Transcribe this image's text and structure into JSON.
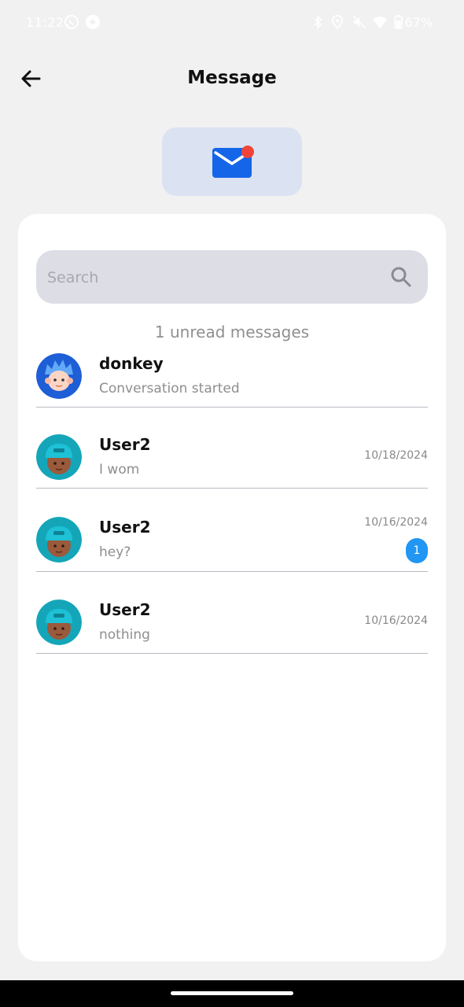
{
  "status_bar": {
    "time": "11:22",
    "battery_percent": "67%",
    "left_icons": [
      "whatsapp-icon",
      "browser-icon"
    ],
    "right_icons": [
      "bluetooth-icon",
      "location-icon",
      "mute-icon",
      "wifi-icon",
      "battery-icon"
    ]
  },
  "header": {
    "title": "Message"
  },
  "search": {
    "placeholder": "Search",
    "value": ""
  },
  "unread_summary": "1 unread messages",
  "conversations": [
    {
      "name": "donkey",
      "preview": "Conversation started",
      "date": "",
      "unread_count": "",
      "avatar": "blue-hair-avatar"
    },
    {
      "name": "User2",
      "preview": "I wom",
      "date": "10/18/2024",
      "unread_count": "",
      "avatar": "cap-boy-avatar"
    },
    {
      "name": "User2",
      "preview": "hey?",
      "date": "10/16/2024",
      "unread_count": "1",
      "avatar": "cap-boy-avatar"
    },
    {
      "name": "User2",
      "preview": "nothing",
      "date": "10/16/2024",
      "unread_count": "",
      "avatar": "cap-boy-avatar"
    }
  ],
  "colors": {
    "background": "#f1f1f1",
    "card": "#ffffff",
    "mail_tile": "#dbe3f2",
    "mail_icon": "#1565e8",
    "notification_dot": "#f04438",
    "badge": "#2196f3",
    "search_bg": "#dddee5"
  }
}
